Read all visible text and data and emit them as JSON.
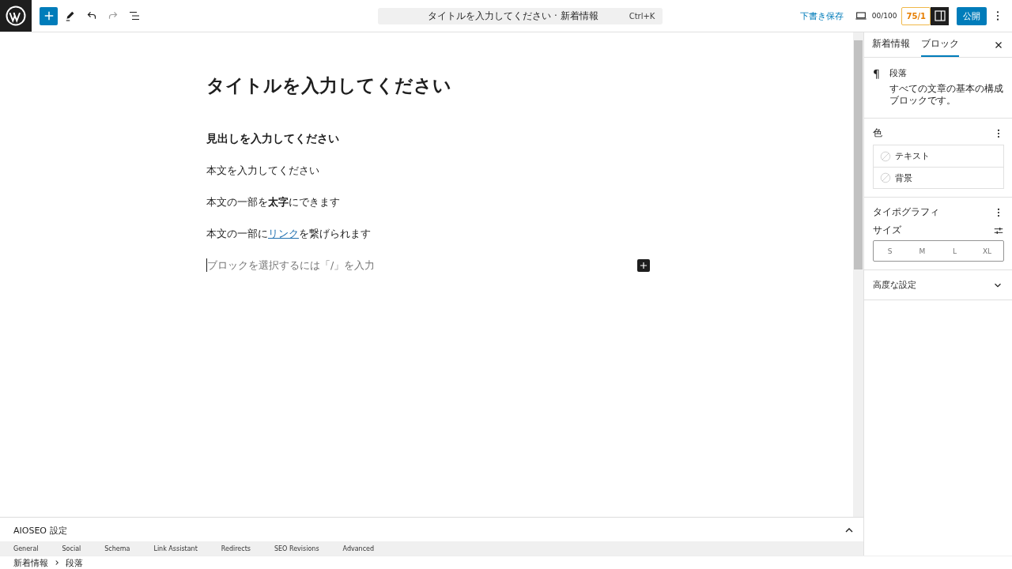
{
  "toolbar": {
    "tools": [
      {
        "kind": "add",
        "selected": true,
        "disabled": false
      },
      {
        "kind": "pen",
        "selected": false,
        "disabled": false
      },
      {
        "kind": "undo",
        "selected": false,
        "disabled": false
      },
      {
        "kind": "redo",
        "selected": false,
        "disabled": true
      },
      {
        "kind": "outline",
        "selected": false,
        "disabled": false
      }
    ],
    "command_bar": {
      "title": "タイトルを入力してください · 新着情報",
      "shortcut": "Ctrl+K"
    },
    "save_draft": "下書き保存",
    "seo_score": "00/100",
    "trueseo_score": "75/1",
    "sidebar_toggle_pressed": true,
    "publish": "公開"
  },
  "editor": {
    "title": "タイトルを入力してください",
    "blocks": [
      {
        "kind": "heading",
        "text": "見出しを入力してください"
      },
      {
        "kind": "paragraph",
        "text": "本文を入力してください"
      },
      {
        "kind": "paragraph",
        "text": "本文の一部を**太字**にできます"
      },
      {
        "kind": "link_paragraph",
        "before": "本文の一部に",
        "link": "リンク",
        "after": "を繋げられます"
      },
      {
        "kind": "placeholder",
        "text": "ブロックを選択するには「/」を入力"
      }
    ]
  },
  "sidebar": {
    "tabs": [
      {
        "label": "新着情報",
        "selected": false
      },
      {
        "label": "ブロック",
        "selected": true
      }
    ],
    "block": {
      "icon": "¶",
      "name": "段落",
      "description": "すべての文章の基本の構成ブロックです。"
    },
    "color": {
      "title": "色",
      "items": [
        "テキスト",
        "背景"
      ]
    },
    "typography": {
      "title": "タイポグラフィ",
      "size_label": "サイズ",
      "sizes": [
        {
          "label": "S",
          "selected": false
        },
        {
          "label": "M",
          "selected": false
        },
        {
          "label": "L",
          "selected": false
        },
        {
          "label": "XL",
          "selected": false
        }
      ]
    },
    "advanced": {
      "title": "高度な設定",
      "expanded": false
    }
  },
  "aioseo": {
    "title": "AIOSEO 設定",
    "expanded": true,
    "tabs": [
      "General",
      "Social",
      "Schema",
      "Link Assistant",
      "Redirects",
      "SEO Revisions",
      "Advanced"
    ]
  },
  "breadcrumb": [
    "新着情報",
    "段落"
  ]
}
